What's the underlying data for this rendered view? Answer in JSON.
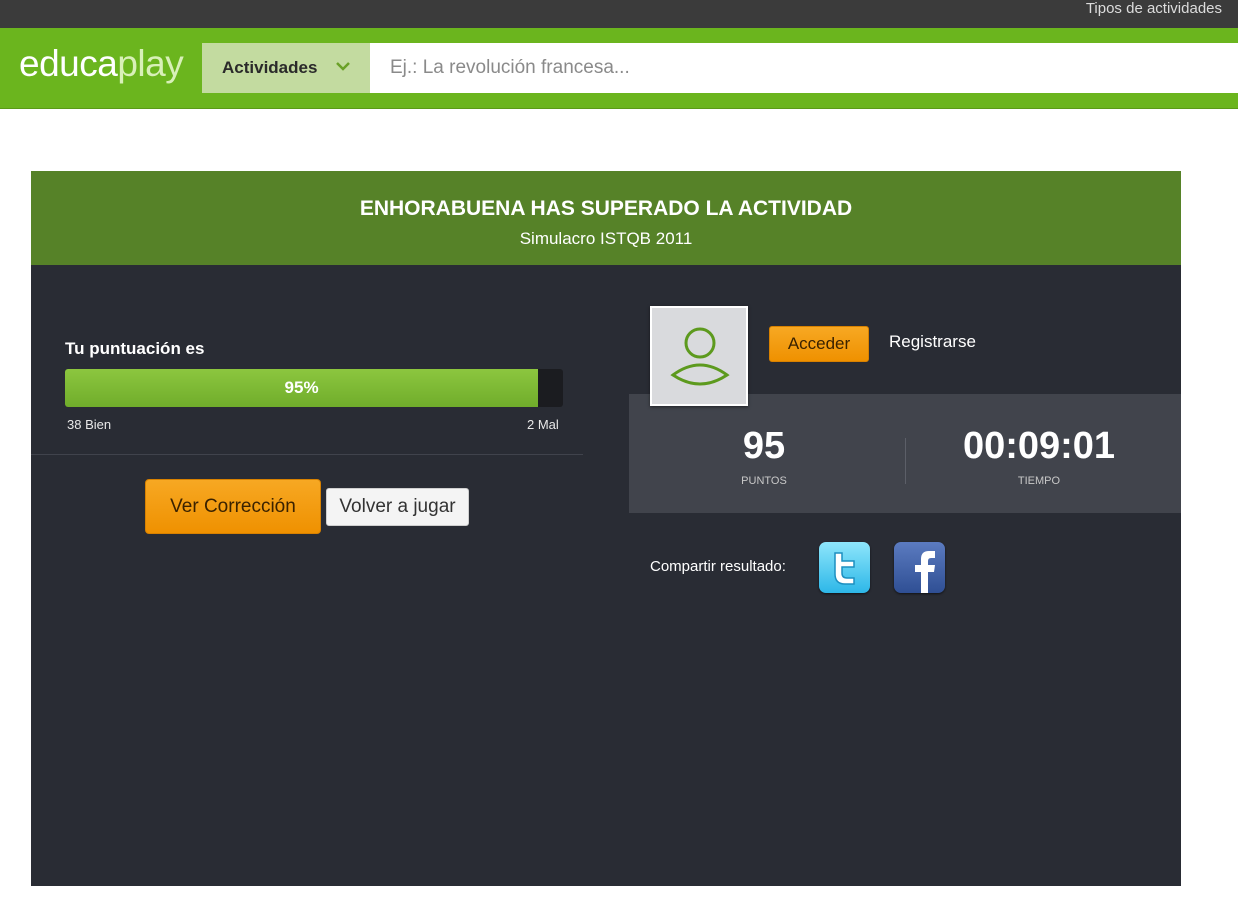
{
  "topbar": {
    "tipos_link": "Tipos de actividades"
  },
  "header": {
    "logo_part1": "educa",
    "logo_part2": "play",
    "actividades_label": "Actividades",
    "search_placeholder": "Ej.: La revolución francesa..."
  },
  "result": {
    "title": "ENHORABUENA HAS SUPERADO LA ACTIVIDAD",
    "activity_name": "Simulacro ISTQB 2011",
    "score_label": "Tu puntuación es",
    "score_percent": 95,
    "score_text": "95%",
    "correct_text": "38 Bien",
    "wrong_text": "2 Mal",
    "ver_correccion_label": "Ver Corrección",
    "volver_jugar_label": "Volver a jugar"
  },
  "user": {
    "acceder_label": "Acceder",
    "registrarse_label": "Registrarse"
  },
  "stats": {
    "points_value": "95",
    "points_label": "PUNTOS",
    "time_value": "00:09:01",
    "time_label": "TIEMPO"
  },
  "share": {
    "label": "Compartir resultado:",
    "networks": [
      "twitter-icon",
      "facebook-icon"
    ]
  },
  "colors": {
    "header_green": "#6bb51e",
    "panel_head_green": "#568228",
    "panel_bg": "#292c34",
    "stats_bg": "#41444c",
    "accent_orange": "#f29a0e",
    "bar_green": "#7fbc36"
  }
}
